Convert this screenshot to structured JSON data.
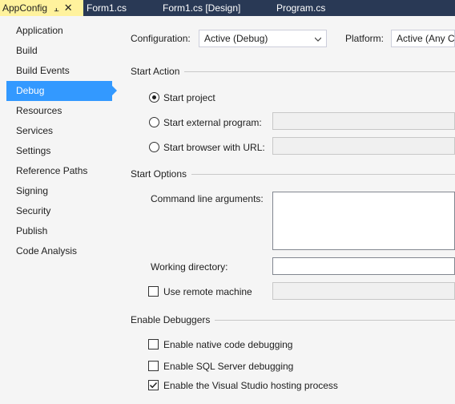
{
  "tabs": [
    {
      "label": "AppConfig",
      "active": true
    },
    {
      "label": "Form1.cs",
      "active": false
    },
    {
      "label": "Form1.cs [Design]",
      "active": false
    },
    {
      "label": "Program.cs",
      "active": false
    }
  ],
  "nav": {
    "items": [
      {
        "label": "Application"
      },
      {
        "label": "Build"
      },
      {
        "label": "Build Events"
      },
      {
        "label": "Debug",
        "selected": true
      },
      {
        "label": "Resources"
      },
      {
        "label": "Services"
      },
      {
        "label": "Settings"
      },
      {
        "label": "Reference Paths"
      },
      {
        "label": "Signing"
      },
      {
        "label": "Security"
      },
      {
        "label": "Publish"
      },
      {
        "label": "Code Analysis"
      }
    ]
  },
  "config": {
    "configuration_label": "Configuration:",
    "configuration_value": "Active (Debug)",
    "platform_label": "Platform:",
    "platform_value": "Active (Any CPU)"
  },
  "start_action": {
    "title": "Start Action",
    "start_project": "Start project",
    "start_external": "Start external program:",
    "start_browser": "Start browser with URL:",
    "selected": "start_project"
  },
  "start_options": {
    "title": "Start Options",
    "cmd_args_label": "Command line arguments:",
    "cmd_args_value": "",
    "working_dir_label": "Working directory:",
    "working_dir_value": "",
    "remote_label": "Use remote machine",
    "remote_checked": false
  },
  "debuggers": {
    "title": "Enable Debuggers",
    "native_label": "Enable native code debugging",
    "native_checked": false,
    "sql_label": "Enable SQL Server debugging",
    "sql_checked": false,
    "vshost_label": "Enable the Visual Studio hosting process",
    "vshost_checked": true
  },
  "colors": {
    "active_tab": "#fff29d",
    "tabbar": "#293955",
    "nav_selected": "#3399ff",
    "background": "#f5f5f5"
  }
}
